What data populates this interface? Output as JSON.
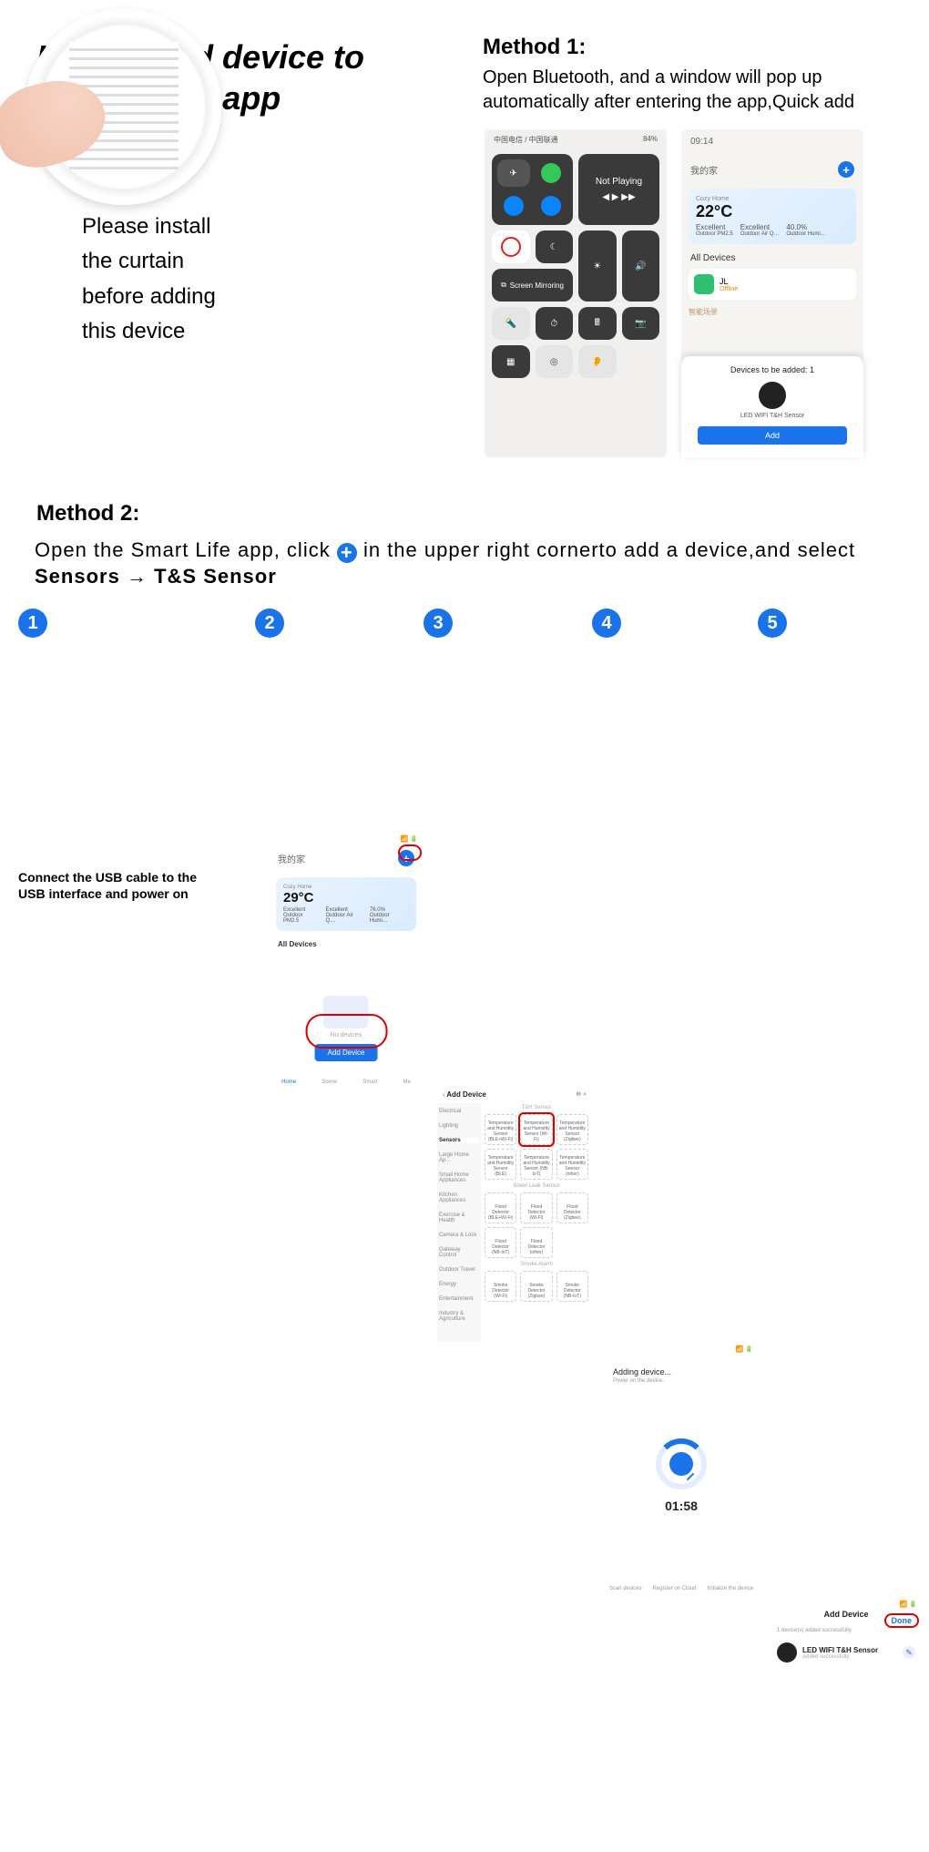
{
  "title": "How to add device to \"smart life\" app",
  "note_l1": "Please install",
  "note_l2": "the curtain",
  "note_l3": "before adding",
  "note_l4": "this device",
  "method1": {
    "label": "Method 1:",
    "text": "Open Bluetooth, and a window will pop up automatically after entering the app,Quick add",
    "left_phone": {
      "carrier": "中国电信 / 中国联通",
      "battery": "84%",
      "not_playing": "Not Playing",
      "screen_mirroring": "Screen Mirroring"
    },
    "right_phone": {
      "time": "09:14",
      "home_label": "我的家",
      "cozy": "Cozy Home",
      "temp": "22°C",
      "stat1_label": "Excellent",
      "stat1_sub": "Outdoor PM2.5",
      "stat2_label": "Excellent",
      "stat2_sub": "Outdoor Air Q…",
      "stat3_label": "40.0%",
      "stat3_sub": "Outdoor Humi…",
      "all_devices": "All Devices",
      "dev_name": "JL",
      "dev_status": "Offline",
      "banner": "智能场景",
      "popup_title": "Devices to be added: 1",
      "popup_dev": "LED WIFI T&H Sensor",
      "popup_btn": "Add"
    }
  },
  "method2": {
    "label": "Method 2:",
    "text_a": "Open the Smart Life app, click ",
    "text_b": " in the upper right cornerto add a device,and select ",
    "bold_a": "Sensors",
    "arrow": "→",
    "bold_b": "T&S Sensor"
  },
  "steps": {
    "s1": {
      "num": "1",
      "caption": "Connect the USB cable to the USB interface and power on"
    },
    "s2": {
      "num": "2",
      "home_label": "我的家",
      "cozy": "Cozy Home",
      "temp": "29°C",
      "stat1": "Excellent",
      "stat1s": "Outdoor PM2.5",
      "stat2": "Excellent",
      "stat2s": "Outdoor Air Q…",
      "stat3": "76.0%",
      "stat3s": "Outdoor Humi…",
      "all_devices": "All Devices",
      "no_devices": "No devices",
      "add_device": "Add Device",
      "tabs": [
        "Home",
        "Scene",
        "Smart",
        "Me"
      ]
    },
    "s3": {
      "num": "3",
      "title": "Add Device",
      "categories": [
        "Electrical",
        "Lighting",
        "Sensors",
        "Large Home Ap…",
        "Small Home Appliances",
        "Kitchen Appliances",
        "Exercise & Health",
        "Camera & Lock",
        "Gateway Control",
        "Outdoor Travel",
        "Energy",
        "Entertainment",
        "Industry & Agriculture"
      ],
      "row1_h": "T&H Sensor",
      "cells_r1": [
        "Temperature and Humidity Sensor (BLE+Wi-Fi)",
        "Temperature and Humidity Sensor (Wi-Fi)",
        "Temperature and Humidity Sensor (Zigbee)"
      ],
      "cells_r2": [
        "Temperature and Humidity Sensor (BLE)",
        "Temperature and Humidity Sensor (NB-IoT)",
        "Temperature and Humidity Sensor (other)"
      ],
      "row2_h": "Water Leak Sensor",
      "cells_r3": [
        "Flood Detector (BLE+Wi-Fi)",
        "Flood Detector (Wi-Fi)",
        "Flood Detector (Zigbee)"
      ],
      "cells_r4": [
        "Flood Detector (NB-IoT)",
        "Flood Detector (other)",
        ""
      ],
      "row3_h": "Smoke Alarm",
      "cells_r5": [
        "Smoke Detector (Wi-Fi)",
        "Smoke Detector (Zigbee)",
        "Smoke Detector (NB-IoT)"
      ]
    },
    "s4": {
      "num": "4",
      "title": "Adding device...",
      "sub": "Power on the device.",
      "timer": "01:58",
      "bottom": [
        "Scan devices",
        "Register on Cloud",
        "Initialize the device"
      ]
    },
    "s5": {
      "num": "5",
      "title": "Add Device",
      "done": "Done",
      "summary": "1 device(s) added successfully",
      "dev": "LED WIFI T&H Sensor",
      "dev_sub": "Added successfully"
    }
  }
}
